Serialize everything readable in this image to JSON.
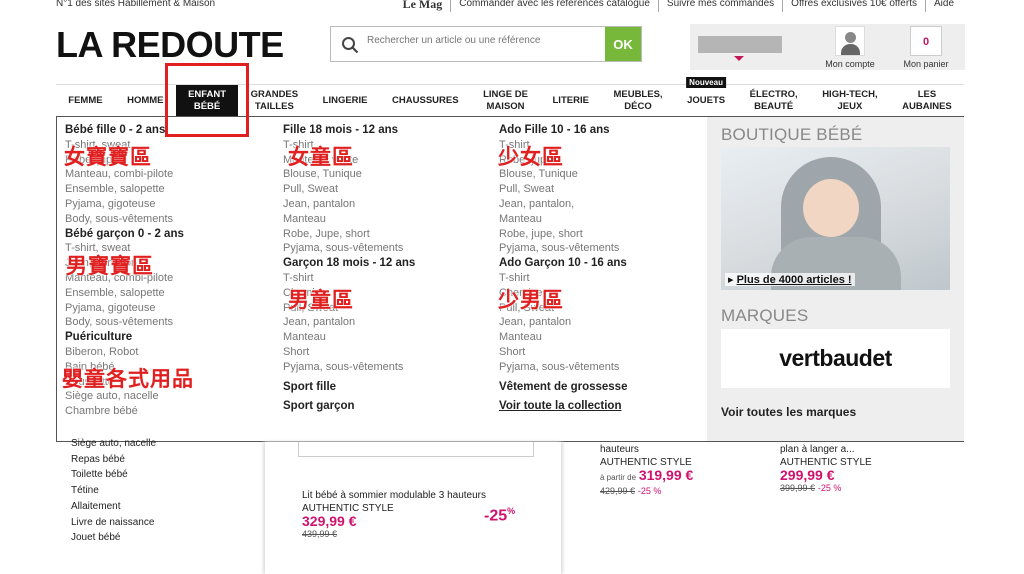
{
  "topbar": {
    "tagline": "N°1 des sites Habillement & Maison",
    "links": [
      "Le Mag",
      "Commander avec les références catalogue",
      "Suivre mes commandes",
      "Offres exclusives 10€ offerts",
      "Aide"
    ]
  },
  "header": {
    "logo": "LA REDOUTE",
    "search_placeholder": "Rechercher un article ou une référence",
    "search_button": "OK",
    "account_label": "Mon compte",
    "cart_label": "Mon panier",
    "cart_count": "0"
  },
  "nav": {
    "items": [
      {
        "label": "FEMME"
      },
      {
        "label": "HOMME"
      },
      {
        "label": "ENFANT\nBÉBÉ"
      },
      {
        "label": "GRANDES\nTAILLES"
      },
      {
        "label": "LINGERIE"
      },
      {
        "label": "CHAUSSURES"
      },
      {
        "label": "LINGE DE\nMAISON"
      },
      {
        "label": "LITERIE"
      },
      {
        "label": "MEUBLES,\nDÉCO"
      },
      {
        "label": "JOUETS"
      },
      {
        "label": "ÉLECTRO,\nBEAUTÉ"
      },
      {
        "label": "HIGH-TECH,\nJEUX"
      },
      {
        "label": "LES\nAUBAINES"
      }
    ],
    "nouveau_badge": "Nouveau"
  },
  "mega": {
    "col1": {
      "h1": "Bébé fille 0 - 2 ans",
      "g1": [
        "T-shirt, sweat",
        "Robe, jupe",
        "Manteau, combi-pilote",
        "Ensemble, salopette",
        "Pyjama, gigoteuse",
        "Body, sous-vêtements"
      ],
      "h2": "Bébé garçon 0 - 2 ans",
      "g2": [
        "T-shirt, sweat",
        "Jean, pantalon",
        "Manteau, combi-pilote",
        "Ensemble, salopette",
        "Pyjama, gigoteuse",
        "Body, sous-vêtements"
      ],
      "h3": "Puériculture",
      "g3": [
        "Biberon, Robot",
        "Bain bébé",
        "Poussette",
        "Siège auto, nacelle",
        "Chambre bébé"
      ]
    },
    "col2": {
      "h1": "Fille 18 mois - 12 ans",
      "g1": [
        "T-shirt",
        "Manteau, veste",
        "Blouse, Tunique",
        "Pull, Sweat",
        "Jean, pantalon",
        "Manteau",
        "Robe, Jupe, short",
        "Pyjama, sous-vêtements"
      ],
      "h2": "Garçon 18 mois - 12 ans",
      "g2": [
        "T-shirt",
        "Chemise",
        "Pull, Sweat",
        "Jean, pantalon",
        "Manteau",
        "Short",
        "Pyjama, sous-vêtements"
      ],
      "b1": "Sport fille",
      "b2": "Sport garçon"
    },
    "col3": {
      "h1": "Ado Fille 10 - 16 ans",
      "g1": [
        "T-shirt",
        "Robe, jupe",
        "Blouse, Tunique",
        "Pull, Sweat",
        "Jean, pantalon,",
        "Manteau",
        "Robe, jupe, short",
        "Pyjama, sous-vêtements"
      ],
      "h2": "Ado Garçon 10 - 16 ans",
      "g2": [
        "T-shirt",
        "Chemise",
        "Pull, Sweat",
        "Jean, pantalon",
        "Manteau",
        "Short",
        "Pyjama, sous-vêtements"
      ],
      "b1": "Vêtement de grossesse",
      "b2": "Voir toute la collection"
    },
    "side": {
      "boutique_title": "BOUTIQUE BÉBÉ",
      "more_articles": "Plus de 4000 articles !",
      "marques_title": "MARQUES",
      "brand": "vertbaudet",
      "all_brands": "Voir toutes les marques"
    }
  },
  "annotations": {
    "girl_baby": "女寶寶區",
    "girl": "女童區",
    "teen_girl": "少女區",
    "boy_baby": "男寶寶區",
    "boy": "男童區",
    "teen_boy": "少男區",
    "baby_goods": "嬰童各式用品"
  },
  "below": {
    "list": [
      "Siège auto, nacelle",
      "Repas bébé",
      "Toilette bébé",
      "Tétine",
      "Allaitement",
      "Livre de naissance",
      "Jouet bébé"
    ],
    "product1": {
      "name": "Lit bébé à sommier modulable 3 hauteurs",
      "brand": "AUTHENTIC STYLE",
      "price": "329,99 €",
      "old": "439,99 €",
      "discount": "-25",
      "discount_sup": "%"
    },
    "product2": {
      "name": "hauteurs",
      "brand": "AUTHENTIC STYLE",
      "apartir": "à partir de",
      "price": "319,99 €",
      "old": "429,99 €",
      "pct": "-25 %"
    },
    "product3": {
      "name": "plan à langer a...",
      "brand": "AUTHENTIC STYLE",
      "price": "299,99 €",
      "old": "399,99 €",
      "pct": "-25 %"
    }
  },
  "colors": {
    "accent": "#d0126e",
    "ok_green": "#77b83a",
    "annotation_red": "#e02020"
  }
}
